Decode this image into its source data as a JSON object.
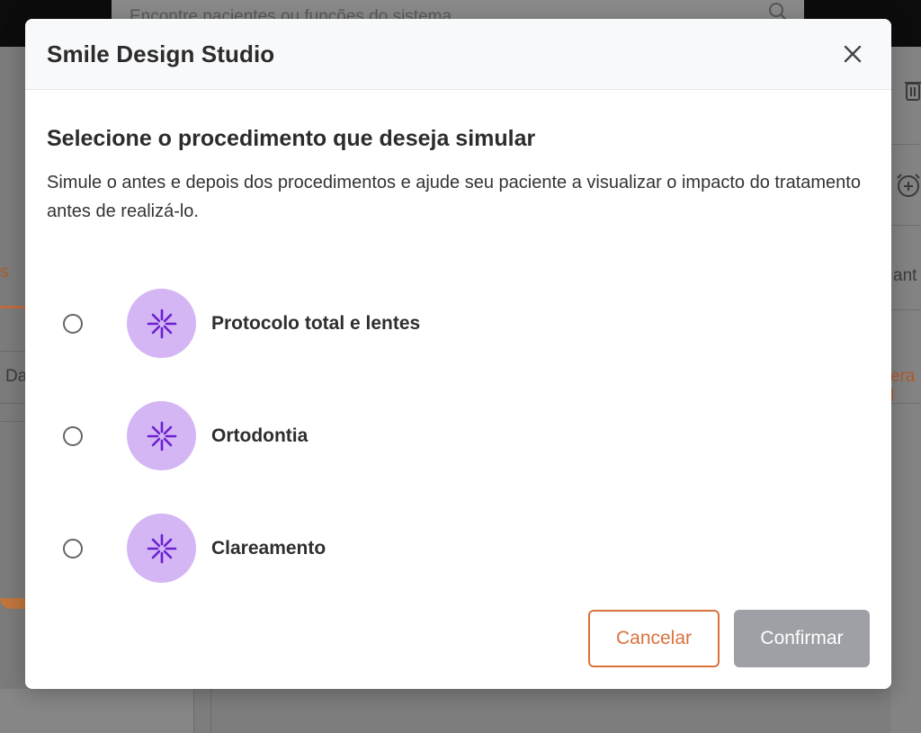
{
  "background": {
    "search_placeholder": "Encontre pacientes ou funções do sistema",
    "left_tab_fragment": "s",
    "left_row_fragment": "Da",
    "right_text_fragment_1": "ant",
    "right_text_fragment_2": "era l"
  },
  "modal": {
    "title": "Smile Design Studio",
    "close_icon": "close-icon",
    "heading": "Selecione o procedimento que deseja simular",
    "description": "Simule o antes e depois dos procedimentos e ajude seu paciente a visualizar o impacto do tratamento antes de realizá-lo.",
    "options": [
      {
        "label": "Protocolo total e lentes",
        "icon": "sparkle-icon",
        "selected": false
      },
      {
        "label": "Ortodontia",
        "icon": "sparkle-icon",
        "selected": false
      },
      {
        "label": "Clareamento",
        "icon": "sparkle-icon",
        "selected": false
      }
    ],
    "cancel_label": "Cancelar",
    "confirm_label": "Confirmar"
  },
  "colors": {
    "accent_orange": "#d9733e",
    "icon_bg_purple": "#d4b6f5",
    "icon_purple": "#6a1fd1",
    "confirm_disabled": "#9ea0a5"
  }
}
